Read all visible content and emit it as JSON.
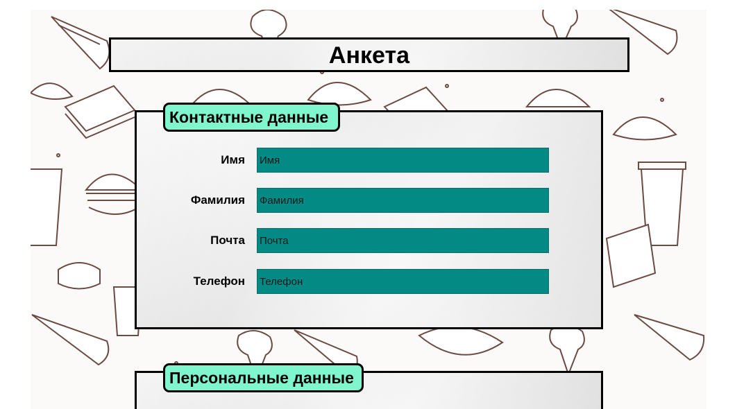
{
  "page": {
    "title": "Анкета"
  },
  "sections": {
    "contacts": {
      "legend": "Контактные данные",
      "fields": [
        {
          "label": "Имя",
          "placeholder": "Имя",
          "value": ""
        },
        {
          "label": "Фамилия",
          "placeholder": "Фамилия",
          "value": ""
        },
        {
          "label": "Почта",
          "placeholder": "Почта",
          "value": ""
        },
        {
          "label": "Телефон",
          "placeholder": "Телефон",
          "value": ""
        }
      ]
    },
    "personal": {
      "legend": "Персональные данные"
    }
  },
  "colors": {
    "background_pattern": "#fbfaf9",
    "doodle_ink": "#6b4a44",
    "panel": "#ececec",
    "legend_bg": "#7ff6cd",
    "input_bg": "#048a84",
    "border": "#000000"
  }
}
